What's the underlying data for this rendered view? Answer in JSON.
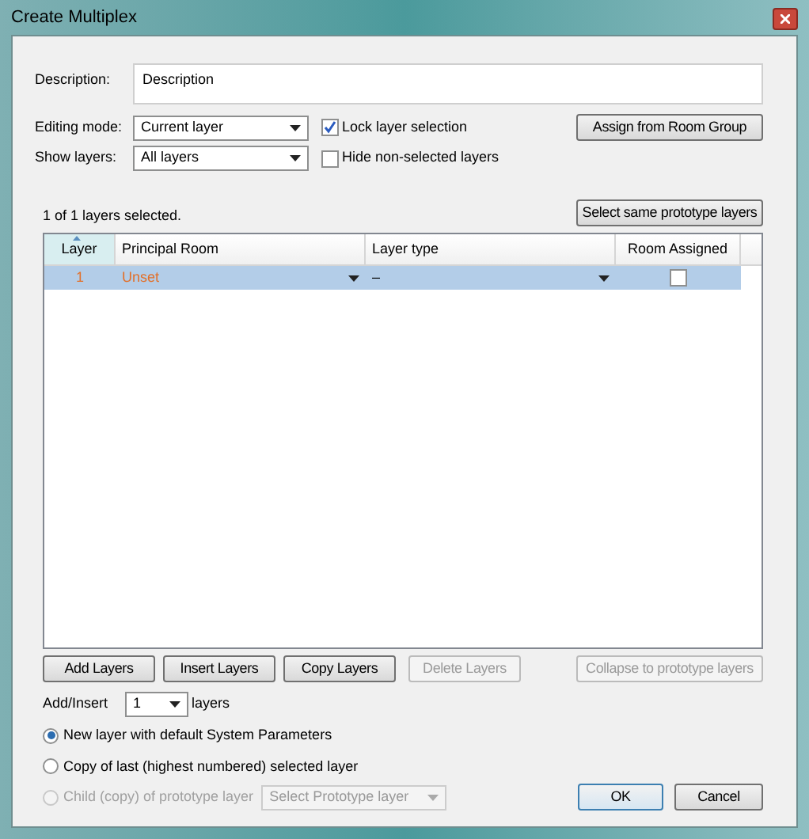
{
  "window": {
    "title": "Create Multiplex"
  },
  "description": {
    "label": "Description:",
    "value": "Description"
  },
  "editing_mode": {
    "label": "Editing mode:",
    "value": "Current layer"
  },
  "lock_selection": {
    "label": "Lock layer selection",
    "checked": true
  },
  "show_layers": {
    "label": "Show layers:",
    "value": "All layers"
  },
  "hide_non_selected": {
    "label": "Hide non-selected layers",
    "checked": false
  },
  "assign_button": "Assign from Room Group",
  "selection_status": "1 of 1 layers selected.",
  "select_same_button": "Select same prototype layers",
  "table": {
    "columns": [
      "Layer",
      "Principal Room",
      "Layer type",
      "Room Assigned"
    ],
    "rows": [
      {
        "layer": "1",
        "principal_room": "Unset",
        "layer_type": "–",
        "room_assigned": false,
        "selected": true
      }
    ]
  },
  "buttons": [
    {
      "label": "Add Layers",
      "disabled": false
    },
    {
      "label": "Insert Layers",
      "disabled": false
    },
    {
      "label": "Copy Layers",
      "disabled": false
    },
    {
      "label": "Delete Layers",
      "disabled": true
    },
    {
      "label": "Collapse to prototype layers",
      "disabled": true
    }
  ],
  "add_insert": {
    "label": "Add/Insert",
    "count": "1",
    "suffix": "layers"
  },
  "options": [
    {
      "label": "New layer with default System Parameters",
      "selected": true,
      "disabled": false
    },
    {
      "label": "Copy of last (highest numbered) selected layer",
      "selected": false,
      "disabled": false
    },
    {
      "label": "Child (copy) of prototype layer",
      "selected": false,
      "disabled": true,
      "select": {
        "placeholder": "Select Prototype layer",
        "disabled": true
      }
    }
  ],
  "ok_button": "OK",
  "cancel_button": "Cancel"
}
